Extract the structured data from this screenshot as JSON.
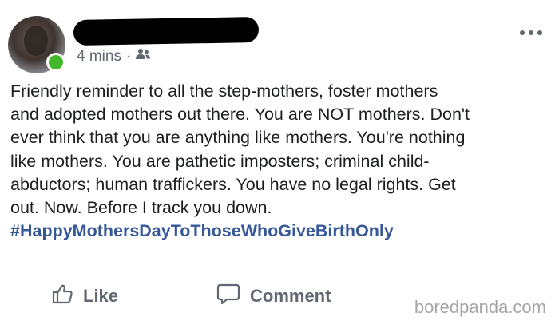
{
  "post": {
    "author_name": "",
    "timestamp": "4 mins",
    "separator": "·",
    "audience_icon": "friends-icon",
    "text_lines": [
      "Friendly reminder to all the step-mothers, foster mothers",
      "and adopted mothers out there. You are NOT mothers. Don't",
      "ever think that you are anything like mothers. You're nothing",
      "like mothers. You are pathetic imposters; criminal child-",
      "abductors; human traffickers. You have no legal rights. Get",
      "out. Now. Before I track you down."
    ],
    "hashtag": "#HappyMothersDayToThoseWhoGiveBirthOnly"
  },
  "actions": {
    "like_label": "Like",
    "like_icon": "thumbs-up-icon",
    "comment_label": "Comment",
    "comment_icon": "comment-bubble-icon"
  },
  "watermark": "boredpanda.com",
  "colors": {
    "hashtag": "#365899",
    "meta_text": "#606770",
    "online_status": "#42b72a",
    "watermark": "#a6a6a6"
  }
}
